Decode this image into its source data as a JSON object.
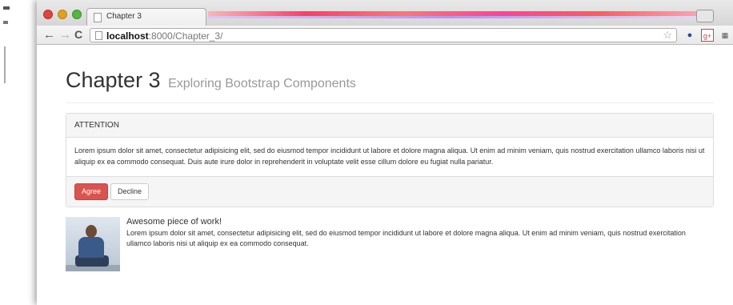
{
  "window": {
    "tab_title": "Chapter 3"
  },
  "toolbar": {
    "back_icon": "←",
    "forward_icon": "→",
    "reload_icon": "C",
    "url_host": "localhost",
    "url_rest": ":8000/Chapter_3/",
    "star_icon": "☆"
  },
  "header": {
    "title": "Chapter 3",
    "subtitle": "Exploring Bootstrap Components"
  },
  "panel": {
    "heading": "ATTENTION",
    "body": "Lorem ipsum dolor sit amet, consectetur adipisicing elit, sed do eiusmod tempor incididunt ut labore et dolore magna aliqua. Ut enim ad minim veniam, quis nostrud exercitation ullamco laboris nisi ut aliquip ex ea commodo consequat. Duis aute irure dolor in reprehenderit in voluptate velit esse cillum dolore eu fugiat nulla pariatur.",
    "agree_label": "Agree",
    "decline_label": "Decline"
  },
  "media": {
    "heading": "Awesome piece of work!",
    "text": "Lorem ipsum dolor sit amet, consectetur adipisicing elit, sed do eiusmod tempor incididunt ut labore et dolore magna aliqua. Ut enim ad minim veniam, quis nostrud exercitation ullamco laboris nisi ut aliquip ex ea commodo consequat."
  },
  "colors": {
    "danger": "#d9534f",
    "panel_bg": "#f5f5f5",
    "border": "#dddddd"
  }
}
